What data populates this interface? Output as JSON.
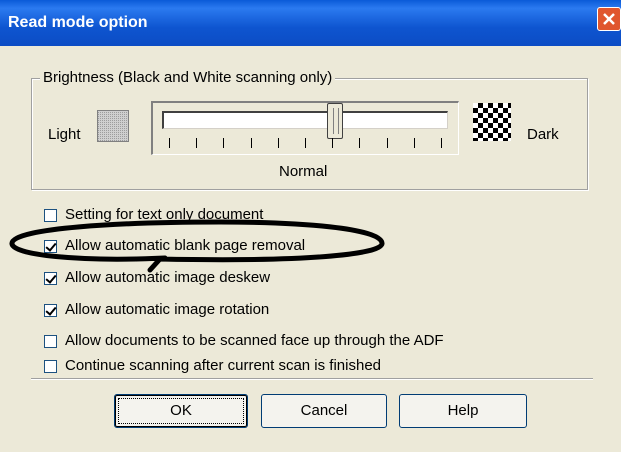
{
  "window": {
    "title": "Read mode option"
  },
  "brightness": {
    "group_title": "Brightness (Black and White scanning only)",
    "light_label": "Light",
    "dark_label": "Dark",
    "normal_label": "Normal",
    "slider_position_fraction": 0.5
  },
  "checkboxes": [
    {
      "label": "Setting for text only document",
      "checked": false
    },
    {
      "label": "Allow automatic blank page removal",
      "checked": true
    },
    {
      "label": "Allow automatic image deskew",
      "checked": true
    },
    {
      "label": "Allow automatic image rotation",
      "checked": true
    },
    {
      "label": "Allow documents to be scanned face up through the ADF",
      "checked": false
    },
    {
      "label": "Continue scanning after current scan is finished",
      "checked": false
    }
  ],
  "buttons": {
    "ok": "OK",
    "cancel": "Cancel",
    "help": "Help"
  },
  "colors": {
    "titlebar": "#0c4cc4",
    "close": "#e0562e",
    "dialog_bg": "#ece9d8"
  },
  "icons": {
    "close": "close-icon",
    "light_pattern": "light-pattern-icon",
    "dark_pattern": "dark-pattern-icon"
  }
}
